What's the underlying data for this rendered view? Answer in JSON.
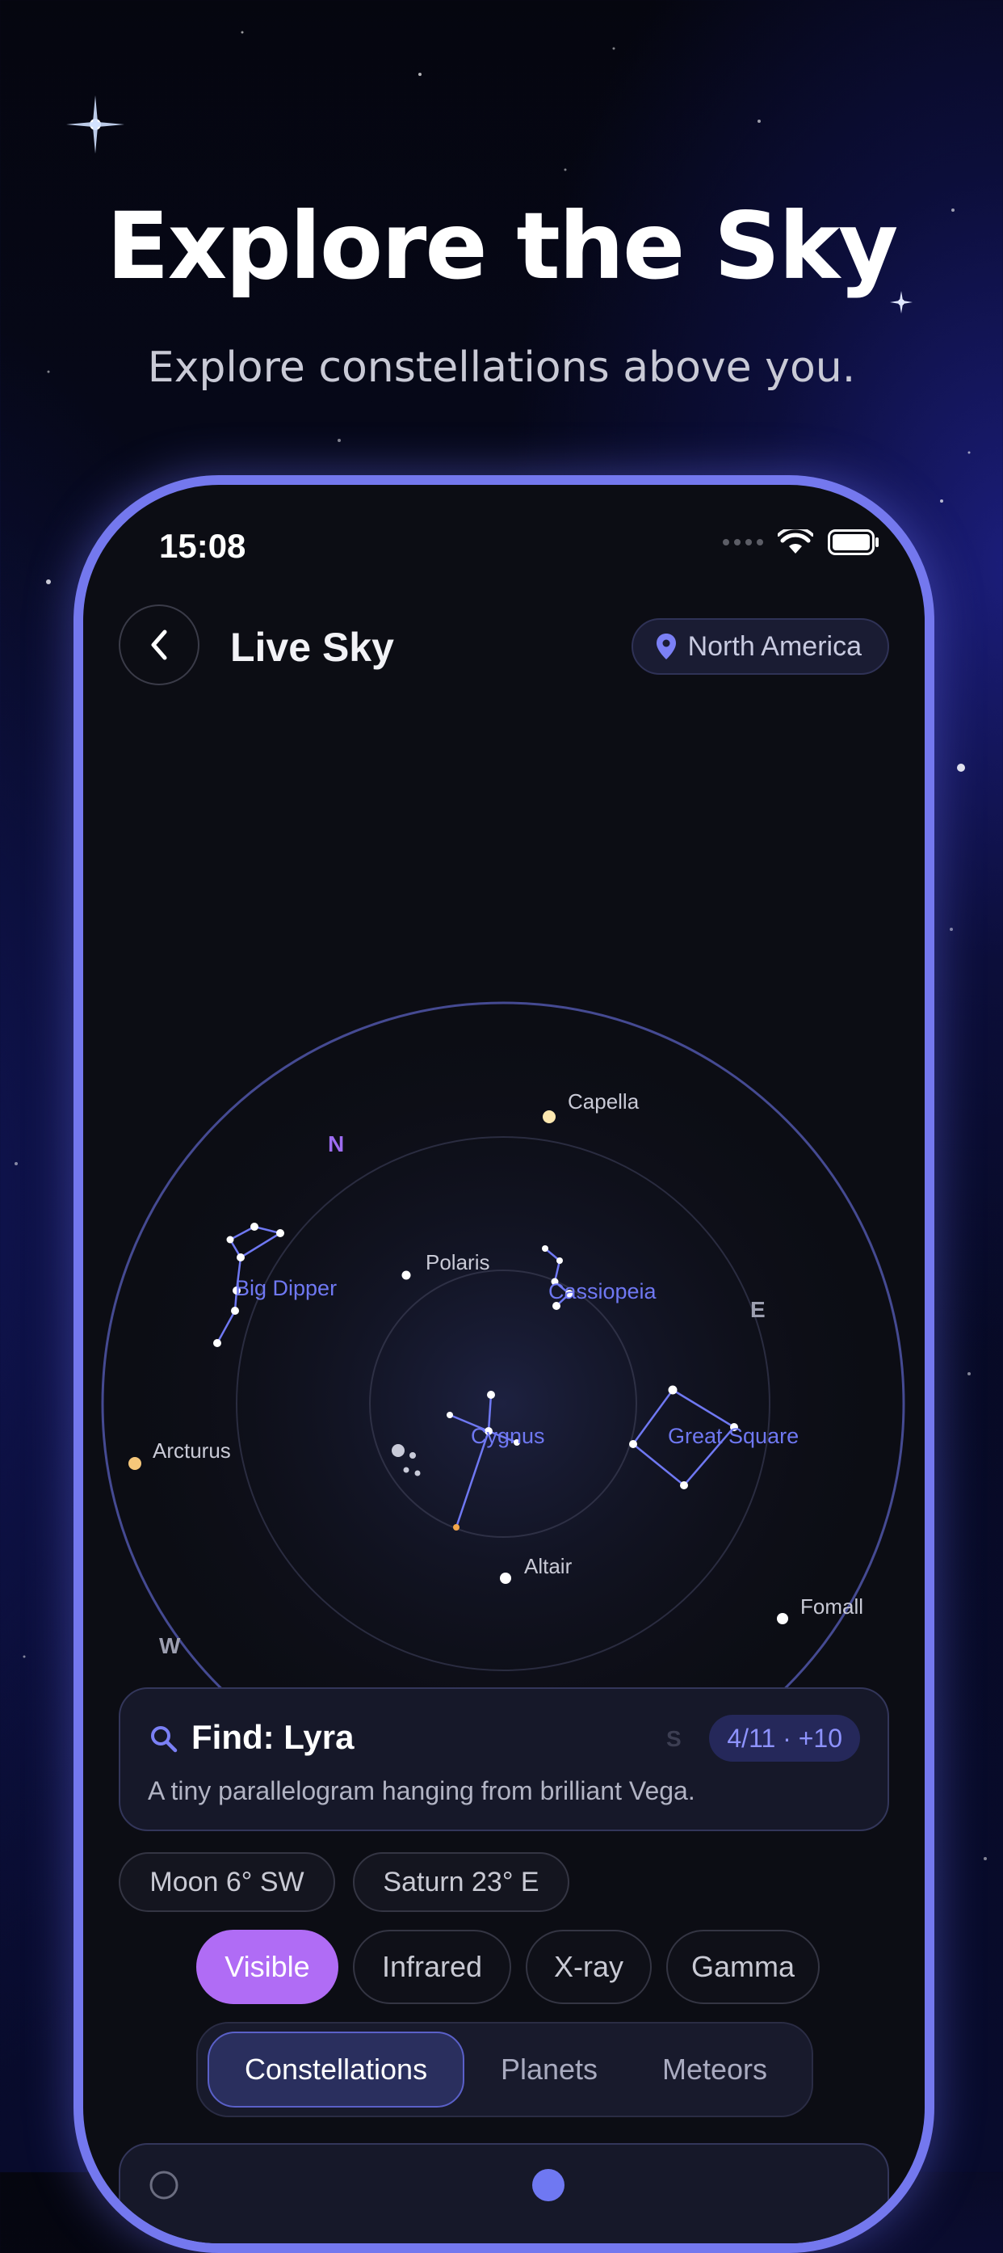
{
  "hero": {
    "title": "Explore the Sky",
    "subtitle": "Explore constellations above you."
  },
  "status_bar": {
    "time": "15:08",
    "icons": [
      "signal-dots-icon",
      "wifi-icon",
      "battery-icon"
    ]
  },
  "nav": {
    "back_icon": "chevron-left-icon",
    "title": "Live Sky",
    "location": "North America",
    "location_icon": "map-pin-icon"
  },
  "sky_map": {
    "directions": {
      "north": "N",
      "east": "E",
      "west": "W",
      "south": "S"
    },
    "stars": {
      "capella": "Capella",
      "polaris": "Polaris",
      "arcturus": "Arcturus",
      "altair": "Altair",
      "fomalhaut": "Fomall"
    },
    "constellations": {
      "big_dipper": "Big Dipper",
      "cassiopeia": "Cassiopeia",
      "great_square": "Great Square",
      "cygnus": "Cygnus"
    }
  },
  "find": {
    "icon": "search-icon",
    "title": "Find: Lyra",
    "badge": "4/11 · +10",
    "description": "A tiny parallelogram hanging from brilliant Vega."
  },
  "chips": [
    "Moon 6° SW",
    "Saturn 23° E"
  ],
  "bands": {
    "items": [
      "Visible",
      "Infrared",
      "X-ray",
      "Gamma"
    ],
    "selected": "Visible"
  },
  "tabs": {
    "items": [
      "Constellations",
      "Planets",
      "Meteors"
    ],
    "selected": "Constellations"
  },
  "colors": {
    "accent": "#b06cf5",
    "device_frame": "#7478ee",
    "constellation_line": "#6f78f2"
  }
}
